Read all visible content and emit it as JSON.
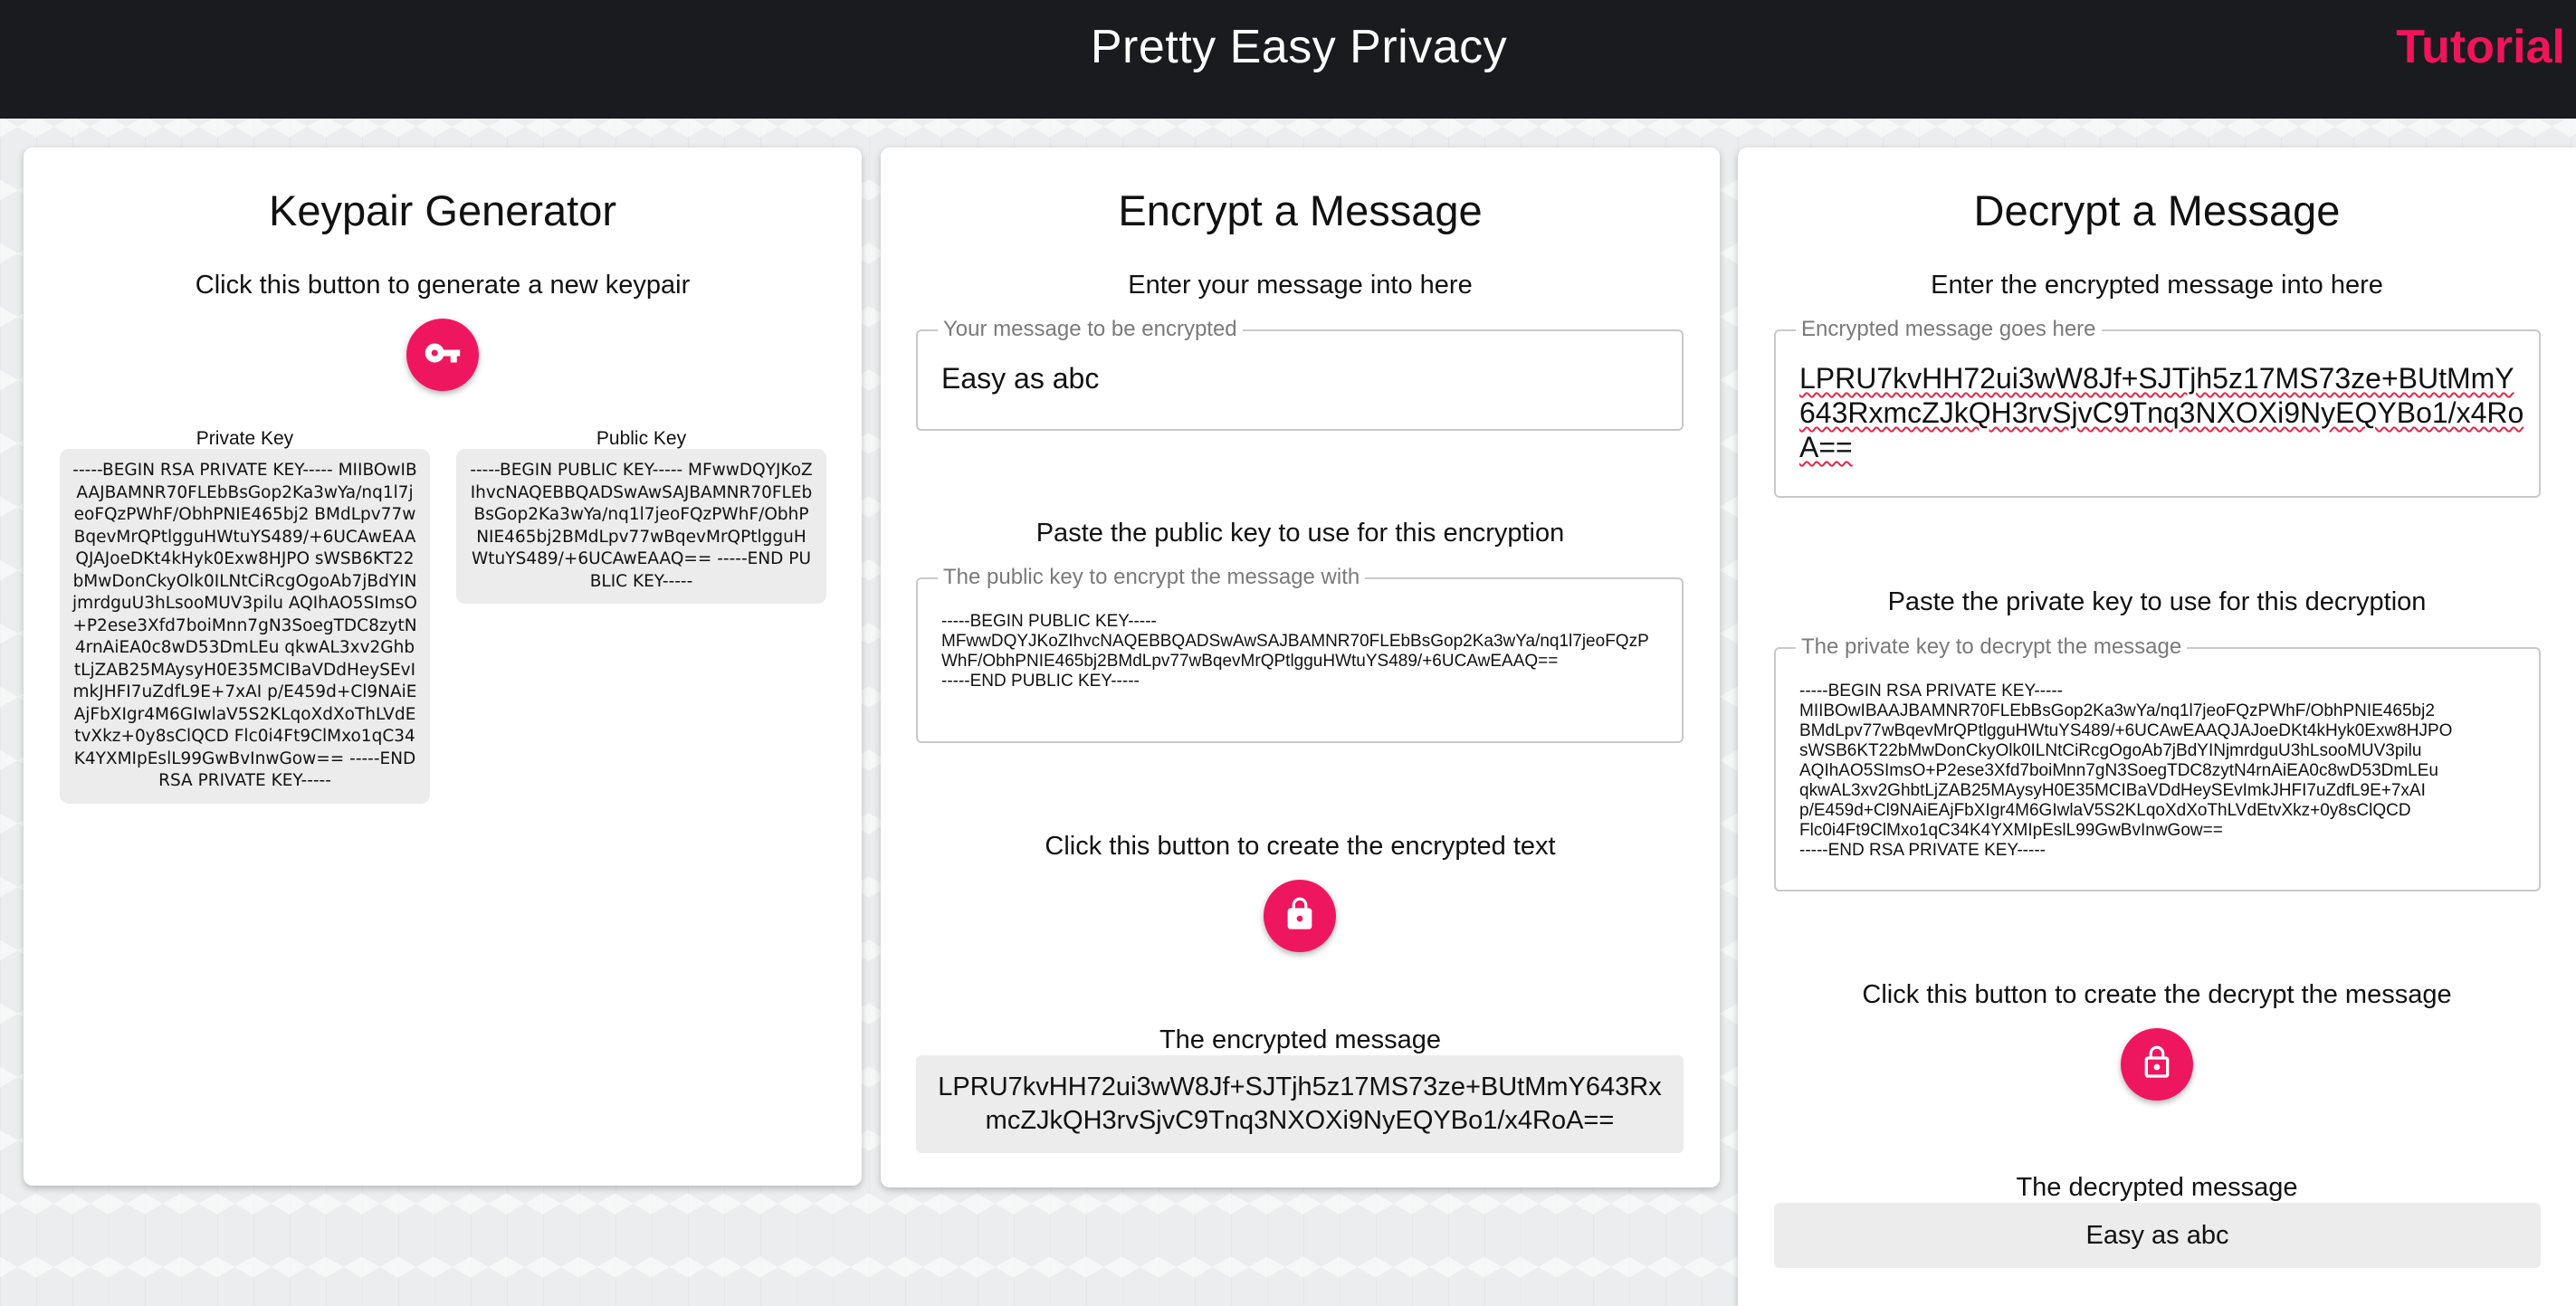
{
  "header": {
    "title": "Pretty Easy Privacy",
    "tutorial_link": "Tutorial"
  },
  "keypair": {
    "title": "Keypair Generator",
    "instruction": "Click this button to generate a new keypair",
    "button_icon": "key-icon",
    "private_key_caption": "Private Key",
    "private_key_value": "-----BEGIN RSA PRIVATE KEY----- MIIBOwIBAAJBAMNR70FLEbBsGop2Ka3wYa/nq1l7jeoFQzPWhF/ObhPNIE465bj2 BMdLpv77wBqevMrQPtlgguHWtuYS489/+6UCAwEAAQJAJoeDKt4kHyk0Exw8HJPO sWSB6KT22bMwDonCkyOlk0ILNtCiRcgOgoAb7jBdYINjmrdguU3hLsooMUV3pilu AQIhAO5SImsO+P2ese3Xfd7boiMnn7gN3SoegTDC8zytN4rnAiEA0c8wD53DmLEu qkwAL3xv2GhbtLjZAB25MAysyH0E35MCIBaVDdHeySEvImkJHFI7uZdfL9E+7xAI p/E459d+Cl9NAiEAjFbXIgr4M6GIwlaV5S2KLqoXdXoThLVdEtvXkz+0y8sClQCD Flc0i4Ft9ClMxo1qC34K4YXMIpEslL99GwBvInwGow== -----END RSA PRIVATE KEY-----",
    "public_key_caption": "Public Key",
    "public_key_value": "-----BEGIN PUBLIC KEY----- MFwwDQYJKoZIhvcNAQEBBQADSwAwSAJBAMNR70FLEbBsGop2Ka3wYa/nq1l7jeoFQzPWhF/ObhPNIE465bj2BMdLpv77wBqevMrQPtlgguHWtuYS489/+6UCAwEAAQ== -----END PUBLIC KEY-----"
  },
  "encrypt": {
    "title": "Encrypt a Message",
    "message_instruction": "Enter your message into here",
    "message_label": "Your message to be encrypted",
    "message_value": "Easy as abc",
    "pubkey_instruction": "Paste the public key to use for this encryption",
    "pubkey_label": "The public key to encrypt the message with",
    "pubkey_value": "-----BEGIN PUBLIC KEY-----\nMFwwDQYJKoZIhvcNAQEBBQADSwAwSAJBAMNR70FLEbBsGop2Ka3wYa/nq1l7jeoFQzPWhF/ObhPNIE465bj2BMdLpv77wBqevMrQPtlgguHWtuYS489/+6UCAwEAAQ==\n-----END PUBLIC KEY-----",
    "button_instruction": "Click this button to create the encrypted text",
    "button_icon": "lock-icon",
    "result_label": "The encrypted message",
    "result_value": "LPRU7kvHH72ui3wW8Jf+SJTjh5z17MS73ze+BUtMmY643RxmcZJkQH3rvSjvC9Tnq3NXOXi9NyEQYBo1/x4RoA=="
  },
  "decrypt": {
    "title": "Decrypt a Message",
    "message_instruction": "Enter the encrypted message into here",
    "message_label": "Encrypted message goes here",
    "message_value": "LPRU7kvHH72ui3wW8Jf+SJTjh5z17MS73ze+BUtMmY643RxmcZJkQH3rvSjvC9Tnq3NXOXi9NyEQYBo1/x4RoA==",
    "privkey_instruction": "Paste the private key to use for this decryption",
    "privkey_label": "The private key to decrypt the message",
    "privkey_value": "-----BEGIN RSA PRIVATE KEY-----\nMIIBOwIBAAJBAMNR70FLEbBsGop2Ka3wYa/nq1l7jeoFQzPWhF/ObhPNIE465bj2\nBMdLpv77wBqevMrQPtlgguHWtuYS489/+6UCAwEAAQJAJoeDKt4kHyk0Exw8HJPO\nsWSB6KT22bMwDonCkyOlk0ILNtCiRcgOgoAb7jBdYINjmrdguU3hLsooMUV3pilu\nAQIhAO5SImsO+P2ese3Xfd7boiMnn7gN3SoegTDC8zytN4rnAiEA0c8wD53DmLEu\nqkwAL3xv2GhbtLjZAB25MAysyH0E35MCIBaVDdHeySEvImkJHFI7uZdfL9E+7xAI\np/E459d+Cl9NAiEAjFbXIgr4M6GIwlaV5S2KLqoXdXoThLVdEtvXkz+0y8sClQCD\nFlc0i4Ft9ClMxo1qC34K4YXMIpEslL99GwBvInwGow==\n-----END RSA PRIVATE KEY-----",
    "button_instruction": "Click this button to create the decrypt the message",
    "button_icon": "unlock-icon",
    "result_label": "The decrypted message",
    "result_value": "Easy as abc"
  },
  "colors": {
    "header_bg": "#1a1b1e",
    "accent": "#ef1660",
    "field_bg": "#ececec"
  }
}
